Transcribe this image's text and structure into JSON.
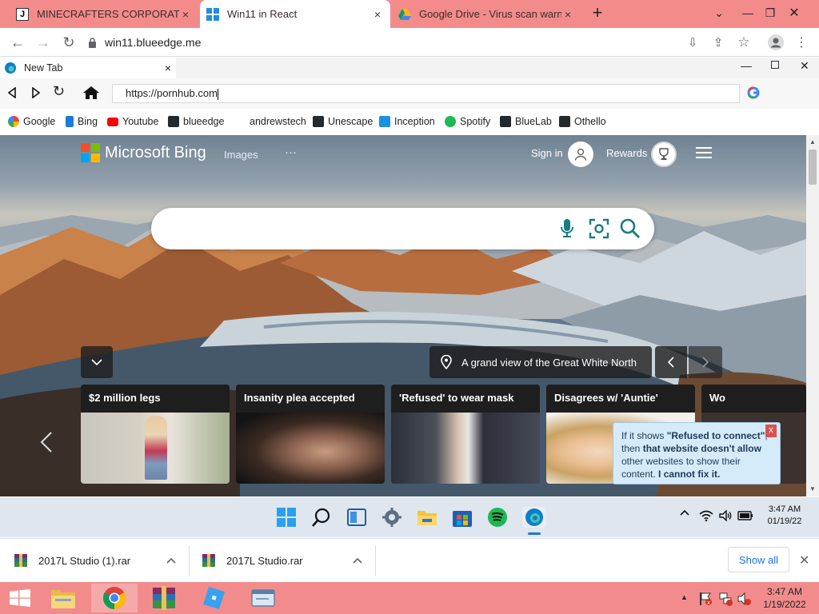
{
  "outer_browser": {
    "tabs": [
      {
        "title": "MINECRAFTERS CORPORATION",
        "favicon": "J"
      },
      {
        "title": "Win11 in React"
      },
      {
        "title": "Google Drive - Virus scan warning"
      }
    ],
    "url": "win11.blueedge.me"
  },
  "inner_browser": {
    "tab_title": "New Tab",
    "address_value": "https://pornhub.com",
    "bookmarks": [
      "Google",
      "Bing",
      "Youtube",
      "blueedge",
      "andrewstech",
      "Unescape",
      "Inception",
      "Spotify",
      "BlueLab",
      "Othello"
    ]
  },
  "bing": {
    "brand": "Microsoft Bing",
    "images_label": "Images",
    "more_label": "···",
    "signin_label": "Sign in",
    "rewards_label": "Rewards",
    "caption": "A grand view of the Great White North",
    "cards": [
      "$2 million legs",
      "Insanity plea accepted",
      "'Refused' to wear mask",
      "Disagrees w/ 'Auntie'",
      "Wo"
    ]
  },
  "notice": {
    "part1": "If it shows ",
    "quote": "\"Refused to connect\"",
    "part2": ", then ",
    "bold1": "that website doesn't allow",
    "part3": " other websites to show their content. ",
    "bold2": "I cannot fix it.",
    "close": "x"
  },
  "win11_taskbar": {
    "time": "3:47 AM",
    "date": "01/19/22"
  },
  "downloads": {
    "items": [
      "2017L Studio (1).rar",
      "2017L Studio.rar"
    ],
    "show_all": "Show all"
  },
  "os_taskbar": {
    "time": "3:47 AM",
    "date": "1/19/2022"
  },
  "colors": {
    "outer_chrome": "#f38b8b",
    "bing_accent": "#1a7b83",
    "win11_taskbar": "#dfe6ee"
  }
}
